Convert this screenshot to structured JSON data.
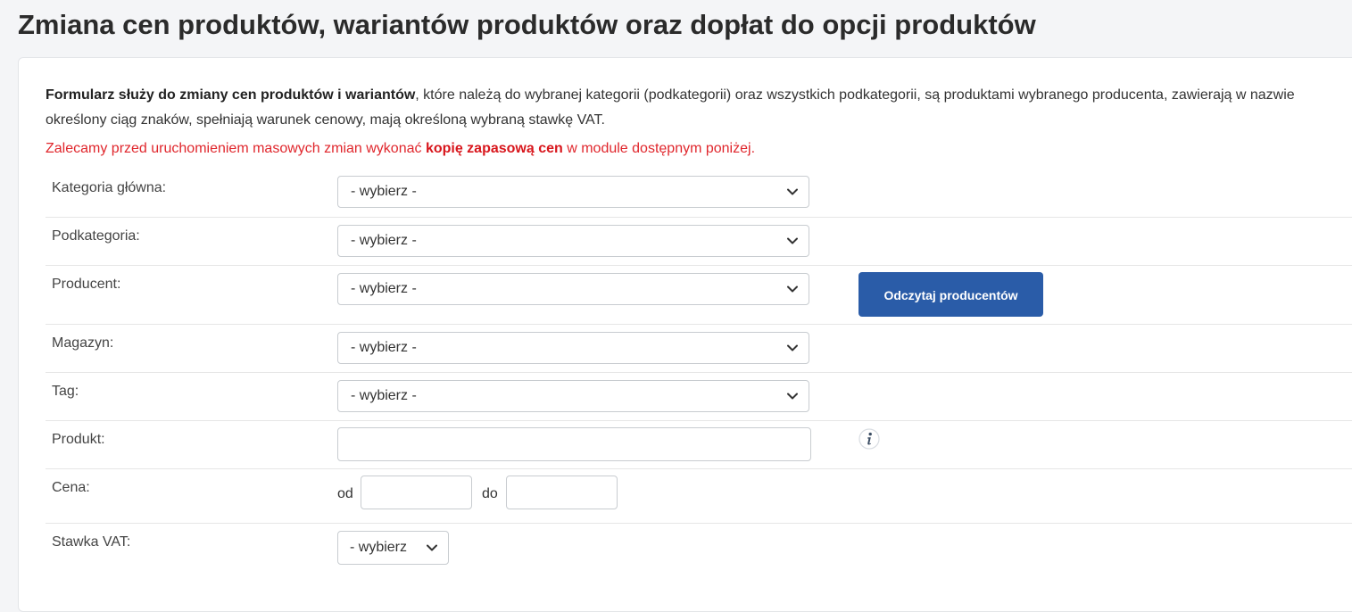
{
  "page": {
    "title": "Zmiana cen produktów, wariantów produktów oraz dopłat do opcji produktów"
  },
  "intro": {
    "bold": "Formularz służy do zmiany cen produktów i wariantów",
    "text": ", które należą do wybranej kategorii (podkategorii) oraz wszystkich podkategorii, są produktami wybranego producenta, zawierają w nazwie określony ciąg znaków, spełniają warunek cenowy, mają określoną wybraną stawkę VAT."
  },
  "warning": {
    "before": "Zalecamy przed uruchomieniem masowych zmian wykonać ",
    "bold": "kopię zapasową cen",
    "after": " w module dostępnym poniżej."
  },
  "form": {
    "category": {
      "label": "Kategoria główna:",
      "value": "- wybierz -"
    },
    "subcategory": {
      "label": "Podkategoria:",
      "value": "- wybierz -"
    },
    "producer": {
      "label": "Producent:",
      "value": "- wybierz -",
      "button_label": "Odczytaj producentów"
    },
    "warehouse": {
      "label": "Magazyn:",
      "value": "- wybierz -"
    },
    "tag": {
      "label": "Tag:",
      "value": "- wybierz -"
    },
    "product": {
      "label": "Produkt:",
      "value": "",
      "info_icon": "info-icon"
    },
    "price": {
      "label": "Cena:",
      "from_label": "od",
      "to_label": "do",
      "from_value": "",
      "to_value": ""
    },
    "vat": {
      "label": "Stawka VAT:",
      "value": "- wybierz"
    }
  },
  "colors": {
    "accent": "#2a5ca8",
    "warning": "#e0262c"
  }
}
